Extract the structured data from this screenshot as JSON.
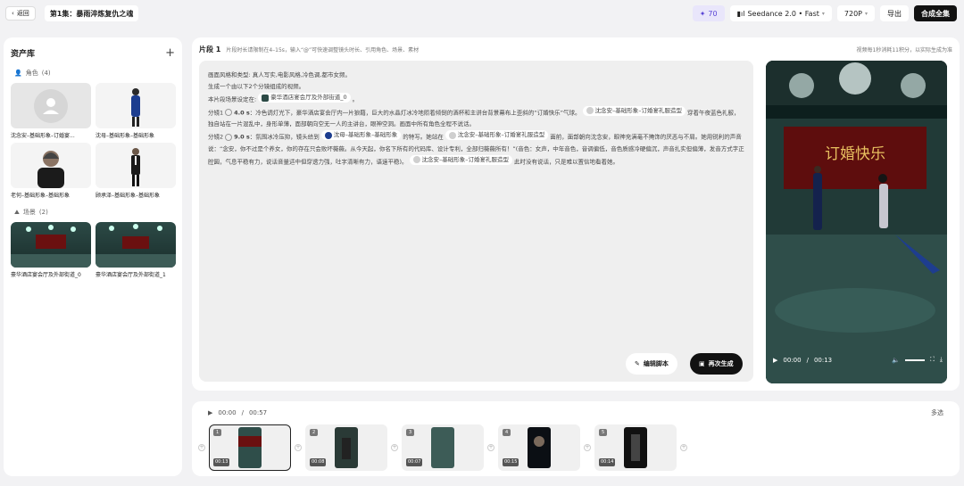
{
  "topbar": {
    "back": "返回",
    "title": "第1集：暴雨淬炼复仇之魂",
    "credits": "70",
    "model": "Seedance 2.0 • Fast",
    "resolution": "720P",
    "export": "导出",
    "compose": "合成全集"
  },
  "assets": {
    "title": "资产库",
    "characters_label": "角色",
    "characters_count": "(4)",
    "characters": [
      {
        "name": "沈念安–基础形象–订婚宴..."
      },
      {
        "name": "沈母–基础形象–基础形象"
      },
      {
        "name": "老何–基础形象–基础形象"
      },
      {
        "name": "顾承泽–基础形象–基础形象"
      }
    ],
    "scenes_label": "场景",
    "scenes_count": "(2)",
    "scenes": [
      {
        "name": "豪华酒店宴会厅及外部街道_0"
      },
      {
        "name": "豪华酒店宴会厅及外部街道_1"
      }
    ]
  },
  "editor": {
    "segment": "片段 1",
    "hint": "片段时长请限制在4–15s，输入“@”可快速调整镜头时长、引用角色、场景、素材",
    "cost_note": "视频每1秒消耗11积分，以实际生成为准",
    "line1": "画面风格和类型: 真人写实,电影风格,冷色调,都市女频。",
    "line2": "生成一个由以下2个分镜组成的视频。",
    "line3_pre": "本片段场景设定在:",
    "scene_ref": "豪华酒店宴会厅及外部街道_0",
    "line3_post": "。",
    "shot1_label": "分镜1",
    "shot1_dur": "4.0 s",
    "shot1_a": "：冷色调灯光下，豪华酒店宴会厅内一片狼藉，巨大的水晶灯冰冷地照着倾倒的酒杯和主讲台背景幕布上歪斜的“订婚快乐”气球。",
    "ref_shen": "沈念安–基础形象–订婚宴礼服造型",
    "shot1_b": "穿着午夜蓝色礼服，独自站在一片混乱中，身形单薄，面部朝向空无一人的主讲台，眼神空洞。画面中所有角色全程不说话。",
    "shot2_label": "分镜2",
    "shot2_dur": "9.0 s",
    "shot2_a": "：氛围冰冷压抑，镜头给到",
    "ref_mother": "沈母–基础形象–基础形象",
    "shot2_b": "的特写。她站在",
    "shot2_c": "面前，面部朝向沈念安，眼神充满毫不掩饰的厌恶与不屑。她用锐利的声音说：“念安，你不过是个养女，你的存在只会败坏薇薇。从今天起，你名下所有的代码库、设计专利，全部归薇薇所有！”(音色：女声，中年音色，音调偏低，音色质感冷硬偏沉，声音扎实但偏薄，发音方式字正腔圆，气息平稳有力，说话音量适中但穿透力强，吐字清晰有力，语速平稳)。",
    "shot2_d": "此时没有说话，只是难以置信地看着她。",
    "edit_script": "编辑脚本",
    "regenerate": "再次生成"
  },
  "player": {
    "current": "00:00",
    "total": "00:13"
  },
  "timeline": {
    "current": "00:00",
    "total": "00:57",
    "multi_select": "多选",
    "clips": [
      {
        "num": "1",
        "dur": "00:13"
      },
      {
        "num": "2",
        "dur": "00:08"
      },
      {
        "num": "3",
        "dur": "00:07"
      },
      {
        "num": "4",
        "dur": "00:15"
      },
      {
        "num": "5",
        "dur": "00:14"
      }
    ]
  },
  "video_text": "订婚快乐"
}
